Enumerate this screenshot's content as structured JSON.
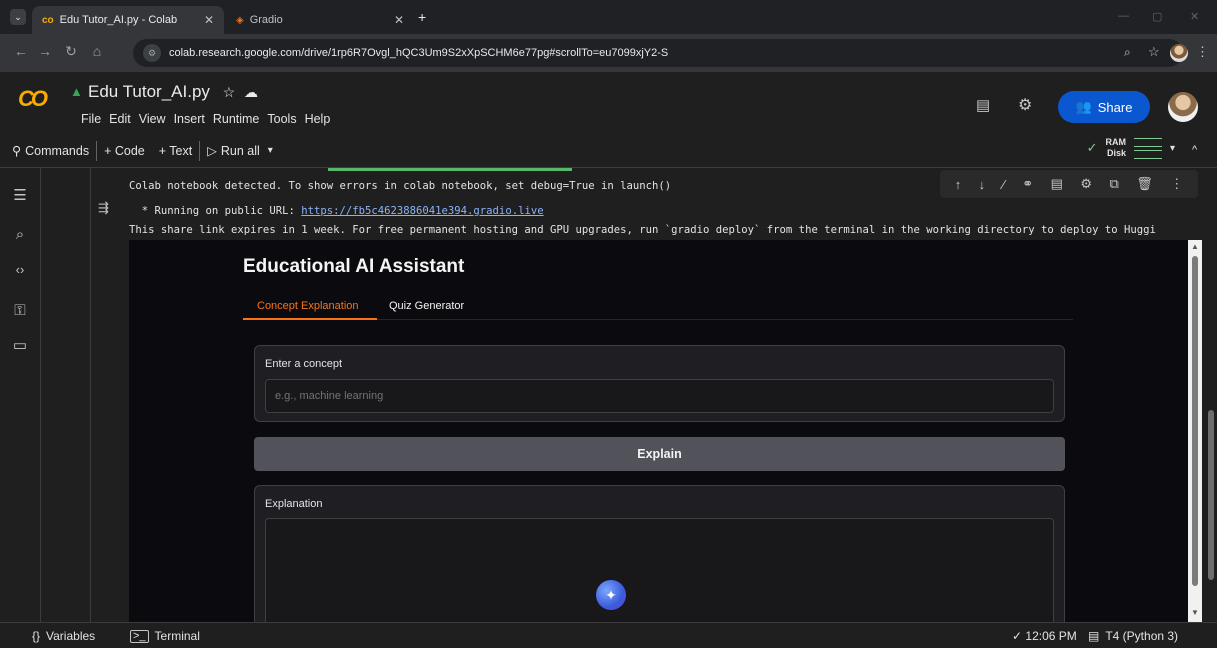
{
  "browser": {
    "tabs": [
      {
        "label": "Edu Tutor_AI.py - Colab",
        "icon": "colab-icon",
        "active": true
      },
      {
        "label": "Gradio",
        "icon": "gradio-icon",
        "active": false
      }
    ],
    "new_tab": "+",
    "url": "colab.research.google.com/drive/1rp6R7Ovgl_hQC3Um9S2xXpSCHM6e77pg#scrollTo=eu7099xjY2-S",
    "window_controls": [
      "—",
      "▢",
      "✕"
    ]
  },
  "colab": {
    "logo": "CO",
    "filename": "Edu Tutor_AI.py",
    "menus": [
      "File",
      "Edit",
      "View",
      "Insert",
      "Runtime",
      "Tools",
      "Help"
    ],
    "share_label": "Share",
    "toolbar": {
      "commands": "Commands",
      "code": "+ Code",
      "text": "+ Text",
      "run_all": "Run all"
    },
    "resources": {
      "ram": "RAM",
      "disk": "Disk"
    },
    "accent": "#0b57d0"
  },
  "output": {
    "line1": "Colab notebook detected. To show errors in colab notebook, set debug=True in launch()",
    "line2_prefix": "* Running on public URL: ",
    "line2_link": "https://fb5c4623886041e394.gradio.live",
    "line3": "This share link expires in 1 week. For free permanent hosting and GPU upgrades, run `gradio deploy` from the terminal in the working directory to deploy to Huggi"
  },
  "gradio": {
    "title": "Educational AI Assistant",
    "tabs": [
      "Concept Explanation",
      "Quiz Generator"
    ],
    "concept_label": "Enter a concept",
    "concept_placeholder": "e.g., machine learning",
    "explain_button": "Explain",
    "explanation_label": "Explanation",
    "accent": "#f97316"
  },
  "statusbar": {
    "variables": "Variables",
    "terminal": "Terminal",
    "time": "✓ 12:06 PM",
    "runtime": "T4 (Python 3)"
  }
}
